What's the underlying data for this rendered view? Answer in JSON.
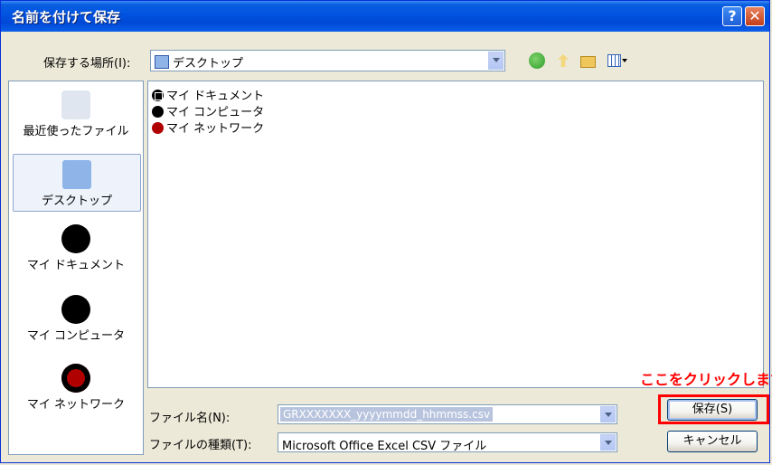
{
  "window": {
    "title": "名前を付けて保存",
    "help_glyph": "?",
    "close_glyph": "✕"
  },
  "toolbar": {
    "lookin_label": "保存する場所(I):",
    "lookin_value": "デスクトップ",
    "icons": [
      "back-icon",
      "up-folder-icon",
      "new-folder-icon",
      "view-menu-icon"
    ]
  },
  "places": [
    {
      "label": "最近使ったファイル",
      "icon": "recent-files-icon"
    },
    {
      "label": "デスクトップ",
      "icon": "desktop-icon",
      "selected": true
    },
    {
      "label": "マイ ドキュメント",
      "icon": "my-documents-icon"
    },
    {
      "label": "マイ コンピュータ",
      "icon": "my-computer-icon"
    },
    {
      "label": "マイ ネットワーク",
      "icon": "my-network-icon"
    }
  ],
  "files": [
    {
      "name": "マイ ドキュメント",
      "icon": "my-documents-icon"
    },
    {
      "name": "マイ コンピュータ",
      "icon": "my-computer-icon"
    },
    {
      "name": "マイ ネットワーク",
      "icon": "my-network-icon"
    }
  ],
  "form": {
    "filename_label": "ファイル名(N):",
    "filename_value": "GRXXXXXXX_yyyymmdd_hhmmss.csv",
    "filetype_label": "ファイルの種類(T):",
    "filetype_value": "Microsoft Office Excel CSV ファイル"
  },
  "buttons": {
    "save": "保存(S)",
    "cancel": "キャンセル"
  },
  "annotation": {
    "text": "ここをクリックします",
    "color": "#ff0000"
  }
}
